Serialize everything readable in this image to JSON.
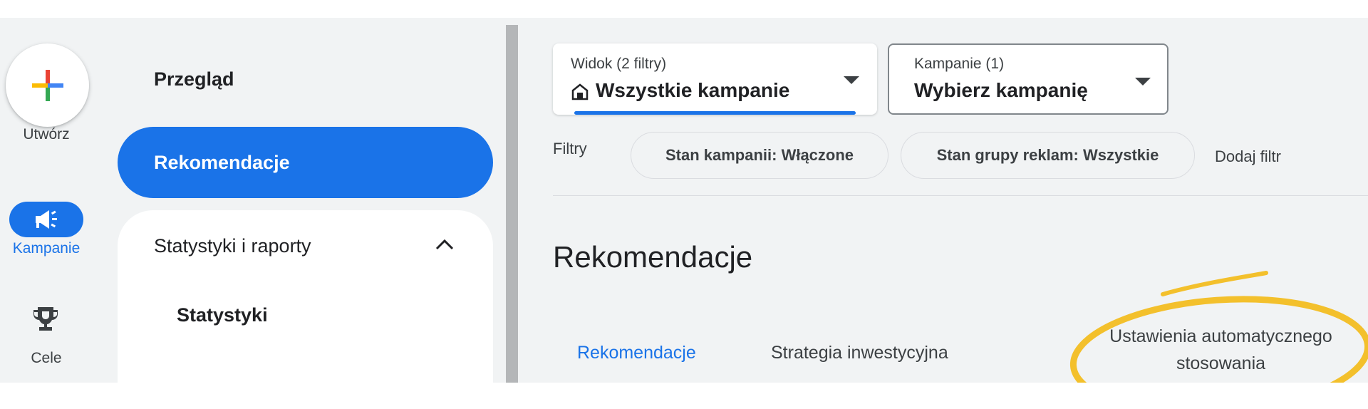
{
  "rail": {
    "create_label": "Utwórz",
    "campaigns_label": "Kampanie",
    "goals_label": "Cele"
  },
  "nav": {
    "overview": "Przegląd",
    "recommendations": "Rekomendacje",
    "stats_reports": "Statystyki i raporty",
    "stats": "Statystyki"
  },
  "view_dropdown": {
    "label": "Widok (2 filtry)",
    "value": "Wszystkie kampanie"
  },
  "campaign_dropdown": {
    "label": "Kampanie (1)",
    "value": "Wybierz kampanię"
  },
  "filters": {
    "label": "Filtry",
    "chips": [
      "Stan kampanii: Włączone",
      "Stan grupy reklam: Wszystkie"
    ],
    "add": "Dodaj filtr"
  },
  "page_title": "Rekomendacje",
  "tabs": [
    "Rekomendacje",
    "Strategia inwestycyjna",
    "Ustawienia automatycznego stosowania"
  ],
  "colors": {
    "accent": "#1a73e8",
    "highlight": "#f3c02c",
    "background": "#f1f3f4"
  }
}
